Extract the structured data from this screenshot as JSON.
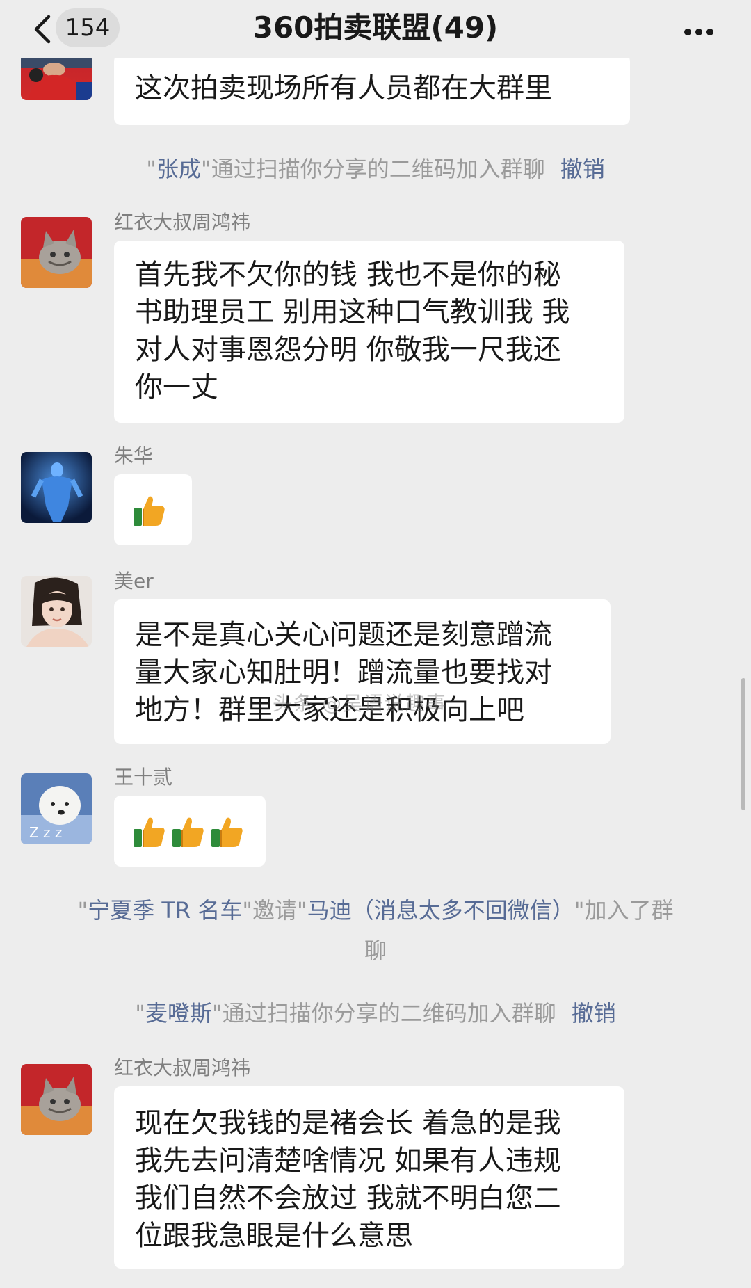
{
  "header": {
    "unread_count": "154",
    "title": "360拍卖联盟(49)"
  },
  "messages": [
    {
      "lines": [
        "这次拍卖现场所有人员都在大群里"
      ]
    },
    {
      "sender": "红衣大叔周鸿祎",
      "lines": [
        "首先我不欠你的钱 我也不是你的秘",
        "书助理员工 别用这种口气教训我 我",
        "对人对事恩怨分明 你敬我一尺我还",
        "你一丈"
      ]
    },
    {
      "sender": "朱华",
      "emoji": "thumbs-up",
      "count": 1
    },
    {
      "sender": "美er",
      "lines": [
        "是不是真心关心问题还是刻意蹭流",
        "量大家心知肚明！蹭流量也要找对",
        "地方！群里大家还是积极向上吧"
      ]
    },
    {
      "sender": "王十贰",
      "emoji": "thumbs-up",
      "count": 3
    },
    {
      "sender": "红衣大叔周鸿祎",
      "lines": [
        "现在欠我钱的是褚会长 着急的是我",
        "我先去问清楚啥情况 如果有人违规",
        "我们自然不会放过 我就不明白您二",
        "位跟我急眼是什么意思"
      ]
    }
  ],
  "system_messages": [
    {
      "q1": "\"",
      "name": "张成",
      "text": "\"通过扫描你分享的二维码加入群聊",
      "action": "撤销"
    },
    {
      "q1": "\"",
      "inviter": "宁夏季 TR 名车",
      "mid": "\"邀请\"",
      "invitee": "马迪（消息太多不回微信）",
      "tail": "\"加入了群",
      "tail2": "聊"
    },
    {
      "q1": "\"",
      "name": "麦噔斯",
      "text": "\"通过扫描你分享的二维码加入群聊",
      "action": "撤销"
    }
  ],
  "watermark": "头条 @吴语说趣事",
  "colors": {
    "background": "#ededed",
    "bubble": "#ffffff",
    "link": "#576b95",
    "system_text": "#9a9a9a",
    "sender_text": "#7f7f7f"
  }
}
